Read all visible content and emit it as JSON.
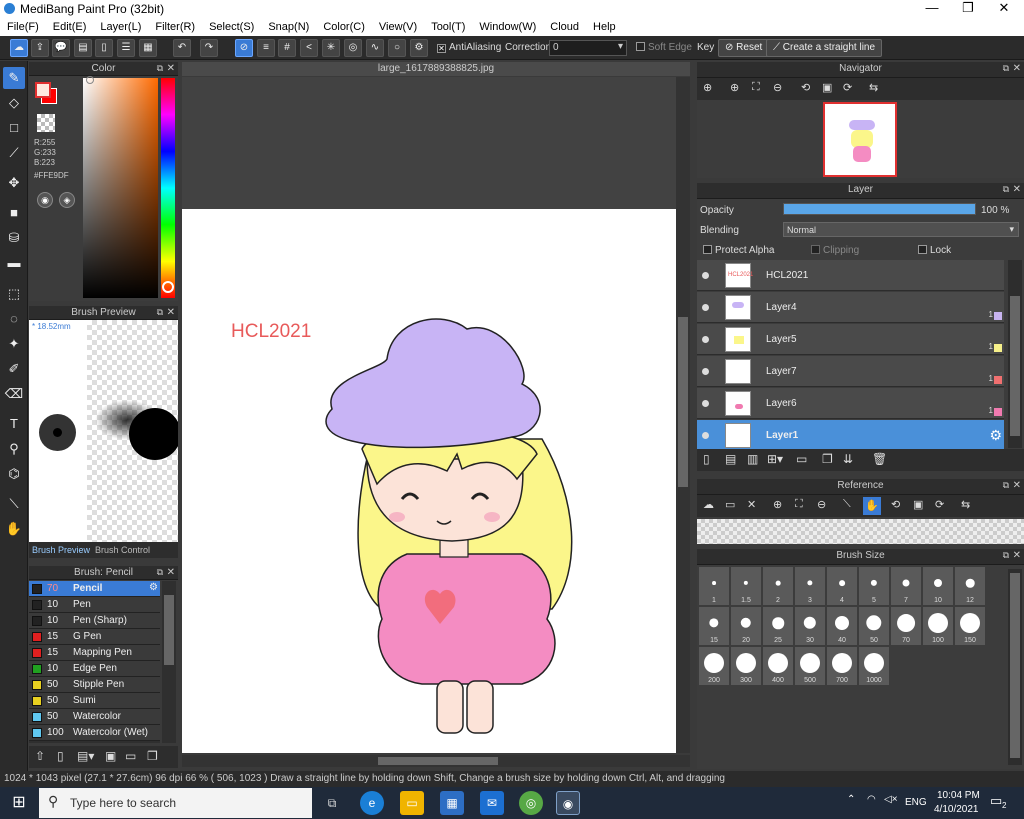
{
  "window": {
    "title": "MediBang Paint Pro (32bit)"
  },
  "menu": [
    "File(F)",
    "Edit(E)",
    "Layer(L)",
    "Filter(R)",
    "Select(S)",
    "Snap(N)",
    "Color(C)",
    "View(V)",
    "Tool(T)",
    "Window(W)",
    "Cloud",
    "Help"
  ],
  "toolbar": {
    "antialiasing_label": "AntiAliasing",
    "correction_label": "Correction",
    "correction_value": "0",
    "soft_edge_label": "Soft Edge",
    "key_label": "Key",
    "reset_label": "Reset",
    "straight_line_label": "Create a straight line"
  },
  "color_panel": {
    "title": "Color",
    "r": "R:255",
    "g": "G:233",
    "b": "B:223",
    "hex": "#FFE9DF",
    "primary_color": "#ffe9df",
    "secondary_color": "#ff0000"
  },
  "brush_preview": {
    "title": "Brush Preview",
    "size": "* 18.52mm",
    "tab_preview": "Brush Preview",
    "tab_control": "Brush Control"
  },
  "brush_panel": {
    "title": "Brush: Pencil",
    "items": [
      {
        "size": "70",
        "name": "Pencil",
        "color": "#222222"
      },
      {
        "size": "10",
        "name": "Pen",
        "color": "#222222"
      },
      {
        "size": "10",
        "name": "Pen (Sharp)",
        "color": "#222222"
      },
      {
        "size": "15",
        "name": "G Pen",
        "color": "#e02020"
      },
      {
        "size": "15",
        "name": "Mapping Pen",
        "color": "#e02020"
      },
      {
        "size": "10",
        "name": "Edge Pen",
        "color": "#20a020"
      },
      {
        "size": "50",
        "name": "Stipple Pen",
        "color": "#e8d020"
      },
      {
        "size": "50",
        "name": "Sumi",
        "color": "#e8d020"
      },
      {
        "size": "50",
        "name": "Watercolor",
        "color": "#60c8f0"
      },
      {
        "size": "100",
        "name": "Watercolor (Wet)",
        "color": "#60c8f0"
      }
    ]
  },
  "document": {
    "tab": "large_1617889388825.jpg",
    "canvas_text": "HCL2021"
  },
  "navigator": {
    "title": "Navigator"
  },
  "layer_panel": {
    "title": "Layer",
    "opacity_label": "Opacity",
    "opacity_value": "100 %",
    "opacity_fraction": 1.0,
    "blending_label": "Blending",
    "blending_value": "Normal",
    "protect_alpha": "Protect Alpha",
    "clipping": "Clipping",
    "lock": "Lock",
    "layers": [
      {
        "name": "HCL2021",
        "chip": "",
        "num": ""
      },
      {
        "name": "Layer4",
        "chip": "#c8b4f0",
        "num": "1"
      },
      {
        "name": "Layer5",
        "chip": "#f6f08a",
        "num": "1"
      },
      {
        "name": "Layer7",
        "chip": "#f07070",
        "num": "1"
      },
      {
        "name": "Layer6",
        "chip": "#f07ab0",
        "num": "1"
      },
      {
        "name": "Layer1",
        "chip": "",
        "num": ""
      }
    ]
  },
  "reference": {
    "title": "Reference"
  },
  "brush_size": {
    "title": "Brush Size",
    "sizes": [
      "1",
      "1.5",
      "2",
      "3",
      "4",
      "5",
      "7",
      "10",
      "12",
      "15",
      "20",
      "25",
      "30",
      "40",
      "50",
      "70",
      "100",
      "150",
      "200",
      "300",
      "400",
      "500",
      "700",
      "1000"
    ]
  },
  "status": {
    "text": "1024 * 1043 pixel   (27.1 * 27.6cm)   96 dpi   66 %   ( 506, 1023 )   Draw a straight line by holding down Shift, Change a brush size by holding down Ctrl, Alt, and dragging"
  },
  "taskbar": {
    "search_placeholder": "Type here to search",
    "language": "ENG",
    "time": "10:04 PM",
    "date": "4/10/2021",
    "notifications": "2"
  }
}
